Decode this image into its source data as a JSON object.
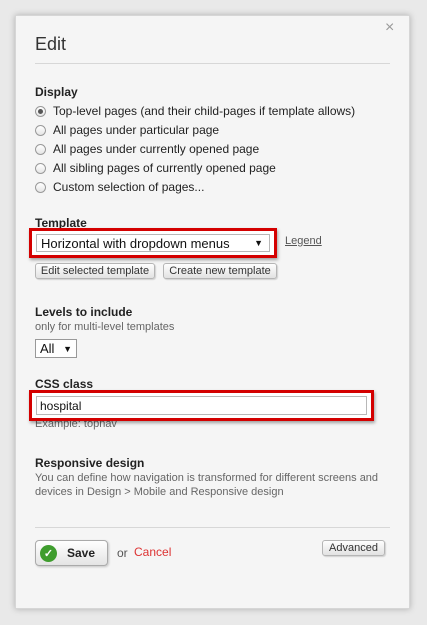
{
  "dialog": {
    "title": "Edit",
    "close_glyph": "×"
  },
  "display": {
    "heading": "Display",
    "options": [
      {
        "label": "Top-level pages (and their child-pages if template allows)",
        "checked": true
      },
      {
        "label": "All pages under particular page",
        "checked": false
      },
      {
        "label": "All pages under currently opened page",
        "checked": false
      },
      {
        "label": "All sibling pages of currently opened page",
        "checked": false
      },
      {
        "label": "Custom selection of pages...",
        "checked": false
      }
    ]
  },
  "template": {
    "heading": "Template",
    "selected": "Horizontal with dropdown menus",
    "legend_link": "Legend",
    "edit_button": "Edit selected template",
    "create_button": "Create new template"
  },
  "levels": {
    "heading": "Levels to include",
    "hint": "only for multi-level templates",
    "selected": "All"
  },
  "css_class": {
    "heading": "CSS class",
    "value": "hospital",
    "example": "Example: topnav"
  },
  "responsive": {
    "heading": "Responsive design",
    "description": "You can define how navigation is transformed for different screens and devices in Design > Mobile and Responsive design"
  },
  "footer": {
    "save_label": "Save",
    "or_text": "or",
    "cancel_label": "Cancel",
    "advanced_label": "Advanced"
  },
  "colors": {
    "highlight_border": "#d40000",
    "save_check": "#3f9d2e",
    "cancel_link": "#dd3333"
  },
  "icons": {
    "select_arrow": "▼",
    "save_check": "✓"
  }
}
